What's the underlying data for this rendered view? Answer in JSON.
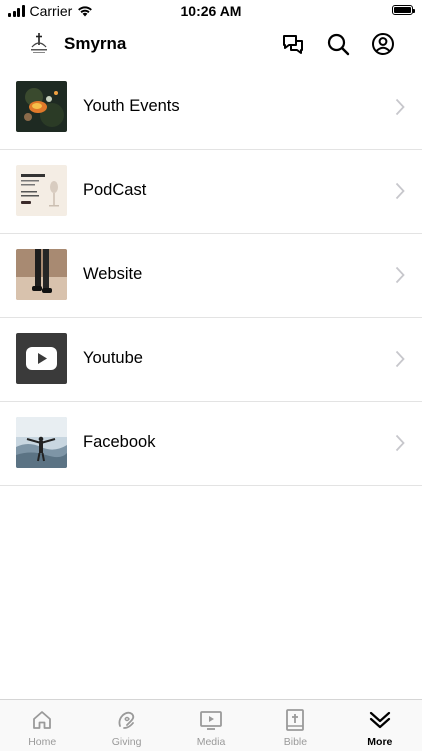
{
  "status_bar": {
    "carrier": "Carrier",
    "time": "10:26 AM"
  },
  "header": {
    "logo_icon": "church-logo-icon",
    "title": "Smyrna",
    "icons": [
      "chat-bubbles-icon",
      "search-icon",
      "profile-icon"
    ]
  },
  "list": {
    "items": [
      {
        "label": "Youth Events",
        "thumb": "youth-events-thumbnail"
      },
      {
        "label": "PodCast",
        "thumb": "podcast-thumbnail"
      },
      {
        "label": "Website",
        "thumb": "website-thumbnail"
      },
      {
        "label": "Youtube",
        "thumb": "youtube-thumbnail"
      },
      {
        "label": "Facebook",
        "thumb": "facebook-thumbnail"
      }
    ]
  },
  "tabbar": {
    "tabs": [
      {
        "label": "Home",
        "icon": "home-icon",
        "active": false
      },
      {
        "label": "Giving",
        "icon": "giving-icon",
        "active": false
      },
      {
        "label": "Media",
        "icon": "media-play-icon",
        "active": false
      },
      {
        "label": "Bible",
        "icon": "bible-icon",
        "active": false
      },
      {
        "label": "More",
        "icon": "double-chevron-down-icon",
        "active": true
      }
    ]
  },
  "colors": {
    "text": "#000000",
    "inactive_tab": "#9a9a9a",
    "divider": "#e3e3e3",
    "chevron": "#c7c7cc"
  }
}
